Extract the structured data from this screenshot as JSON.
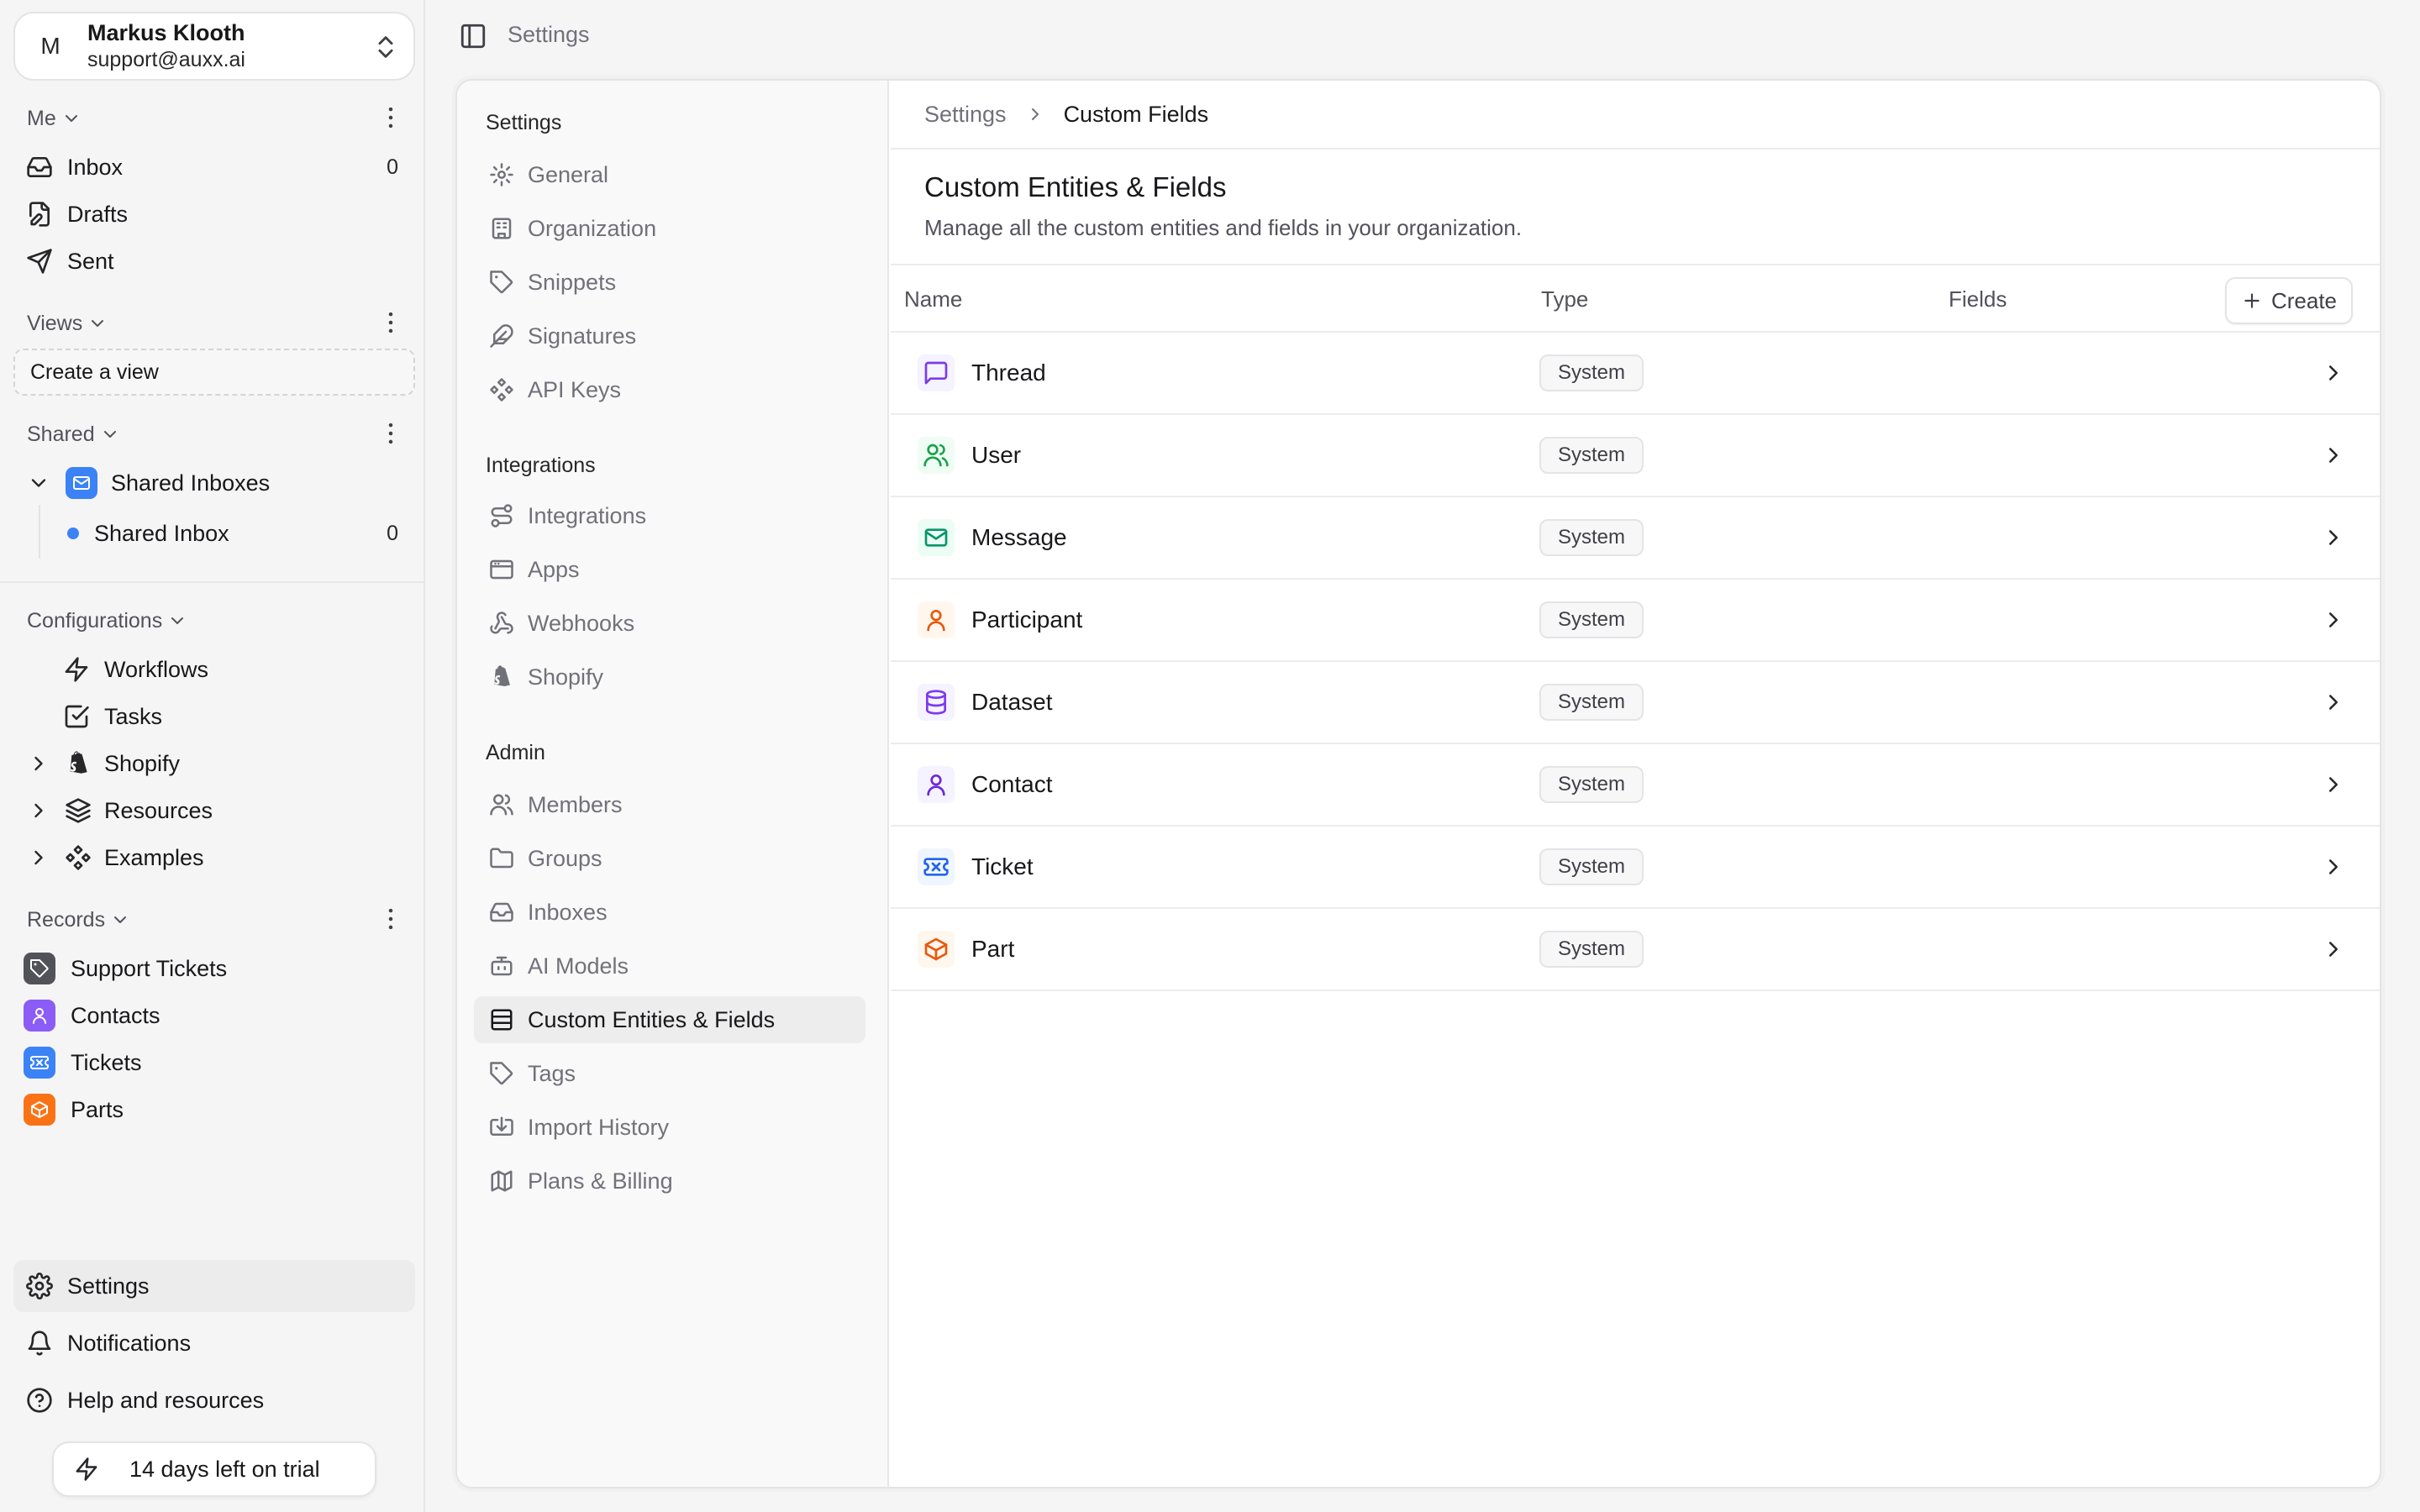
{
  "user": {
    "initial": "M",
    "name": "Markus Klooth",
    "email": "support@auxx.ai"
  },
  "sidebar": {
    "me": {
      "label": "Me",
      "items": [
        {
          "label": "Inbox",
          "count": "0"
        },
        {
          "label": "Drafts"
        },
        {
          "label": "Sent"
        }
      ]
    },
    "views": {
      "label": "Views",
      "create_label": "Create a view"
    },
    "shared": {
      "label": "Shared",
      "group_label": "Shared Inboxes",
      "inbox_label": "Shared Inbox",
      "inbox_count": "0"
    },
    "configurations": {
      "label": "Configurations",
      "items": [
        {
          "label": "Workflows"
        },
        {
          "label": "Tasks"
        },
        {
          "label": "Shopify"
        },
        {
          "label": "Resources"
        },
        {
          "label": "Examples"
        }
      ]
    },
    "records": {
      "label": "Records",
      "items": [
        {
          "label": "Support Tickets",
          "color": "#52525b"
        },
        {
          "label": "Contacts",
          "color": "#8b5cf6"
        },
        {
          "label": "Tickets",
          "color": "#3b82f6"
        },
        {
          "label": "Parts",
          "color": "#f97316"
        }
      ]
    },
    "footer": {
      "settings": "Settings",
      "notifications": "Notifications",
      "help": "Help and resources",
      "trial": "14 days left on trial"
    }
  },
  "topbar": {
    "title": "Settings"
  },
  "settings_nav": {
    "groups": [
      {
        "label": "Settings",
        "items": [
          {
            "label": "General",
            "icon": "gear-icon"
          },
          {
            "label": "Organization",
            "icon": "building-icon"
          },
          {
            "label": "Snippets",
            "icon": "tag-icon"
          },
          {
            "label": "Signatures",
            "icon": "feather-icon"
          },
          {
            "label": "API Keys",
            "icon": "workflow-icon"
          }
        ]
      },
      {
        "label": "Integrations",
        "items": [
          {
            "label": "Integrations",
            "icon": "route-icon"
          },
          {
            "label": "Apps",
            "icon": "app-window-icon"
          },
          {
            "label": "Webhooks",
            "icon": "webhook-icon"
          },
          {
            "label": "Shopify",
            "icon": "shopify-icon"
          }
        ]
      },
      {
        "label": "Admin",
        "items": [
          {
            "label": "Members",
            "icon": "users-icon"
          },
          {
            "label": "Groups",
            "icon": "folder-icon"
          },
          {
            "label": "Inboxes",
            "icon": "inbox-icon"
          },
          {
            "label": "AI Models",
            "icon": "bot-icon"
          },
          {
            "label": "Custom Entities & Fields",
            "icon": "table-icon",
            "active": true
          },
          {
            "label": "Tags",
            "icon": "tag-icon"
          },
          {
            "label": "Import History",
            "icon": "import-icon"
          },
          {
            "label": "Plans & Billing",
            "icon": "map-icon"
          }
        ]
      }
    ]
  },
  "breadcrumb": {
    "parent": "Settings",
    "current": "Custom Fields"
  },
  "page": {
    "title": "Custom Entities & Fields",
    "description": "Manage all the custom entities and fields in your organization."
  },
  "table": {
    "columns": {
      "name": "Name",
      "type": "Type",
      "fields": "Fields"
    },
    "create_label": "Create",
    "rows": [
      {
        "name": "Thread",
        "type": "System",
        "icon": "message-square-icon",
        "color": "#7c3aed",
        "bg": "#f5f3ff"
      },
      {
        "name": "User",
        "type": "System",
        "icon": "users-icon",
        "color": "#16a34a",
        "bg": "#f0fdf4"
      },
      {
        "name": "Message",
        "type": "System",
        "icon": "mail-icon",
        "color": "#059669",
        "bg": "#ecfdf5"
      },
      {
        "name": "Participant",
        "type": "System",
        "icon": "user-icon",
        "color": "#ea580c",
        "bg": "#fff7ed"
      },
      {
        "name": "Dataset",
        "type": "System",
        "icon": "database-icon",
        "color": "#7c3aed",
        "bg": "#f5f3ff"
      },
      {
        "name": "Contact",
        "type": "System",
        "icon": "user-icon",
        "color": "#6d28d9",
        "bg": "#f5f3ff"
      },
      {
        "name": "Ticket",
        "type": "System",
        "icon": "ticket-icon",
        "color": "#2563eb",
        "bg": "#eff6ff"
      },
      {
        "name": "Part",
        "type": "System",
        "icon": "package-icon",
        "color": "#ea580c",
        "bg": "#fff7ed"
      }
    ]
  }
}
